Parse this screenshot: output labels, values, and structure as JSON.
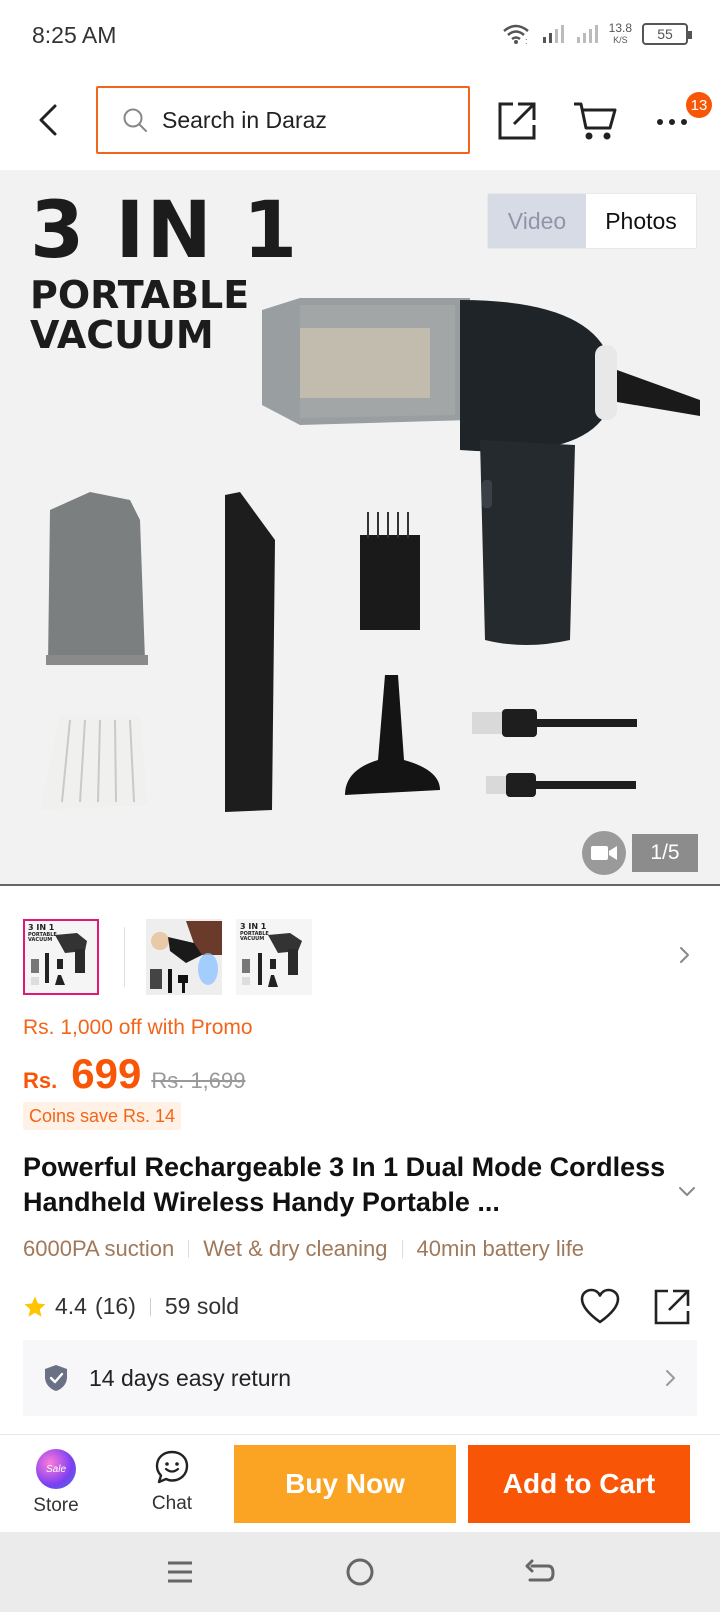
{
  "status_bar": {
    "time": "8:25 AM",
    "speed_value": "13.8",
    "speed_unit": "K/S",
    "battery": "55"
  },
  "header": {
    "search_placeholder": "Search in Daraz",
    "more_badge": "13"
  },
  "gallery": {
    "promo_heading": [
      "3 IN 1",
      "PORTABLE",
      "VACUUM"
    ],
    "tab_video": "Video",
    "tab_photos": "Photos",
    "counter": "1/5"
  },
  "thumbnail_text": [
    "3 IN 1",
    "PORTABLE",
    "VACUUM"
  ],
  "price": {
    "promo": "Rs. 1,000 off with Promo",
    "currency": "Rs.",
    "value": "699",
    "original": "Rs. 1,699",
    "coins": "Coins save Rs. 14"
  },
  "product": {
    "title": "Powerful Rechargeable 3 In 1 Dual Mode Cordless Handheld Wireless Handy Portable ...",
    "features": [
      "6000PA suction",
      "Wet & dry cleaning",
      "40min battery life"
    ],
    "rating": "4.4",
    "reviews": "(16)",
    "sold": "59 sold",
    "return_policy": "14 days easy return"
  },
  "bottom_bar": {
    "store_label": "Store",
    "store_badge": "Sale",
    "chat_label": "Chat",
    "buy_now": "Buy Now",
    "add_to_cart": "Add to Cart"
  },
  "colors": {
    "brand_orange": "#f85606",
    "buy_now_yellow": "#fba323",
    "promo_orange": "#f2651b",
    "thumb_selected": "#e01a73"
  },
  "icons": [
    "back-icon",
    "search-icon",
    "share-icon",
    "cart-icon",
    "more-icon",
    "video-play-icon",
    "chevron-right-icon",
    "chevron-down-icon",
    "star-icon",
    "heart-icon",
    "shield-icon",
    "chat-icon",
    "menu-icon",
    "home-icon",
    "back-nav-icon"
  ]
}
